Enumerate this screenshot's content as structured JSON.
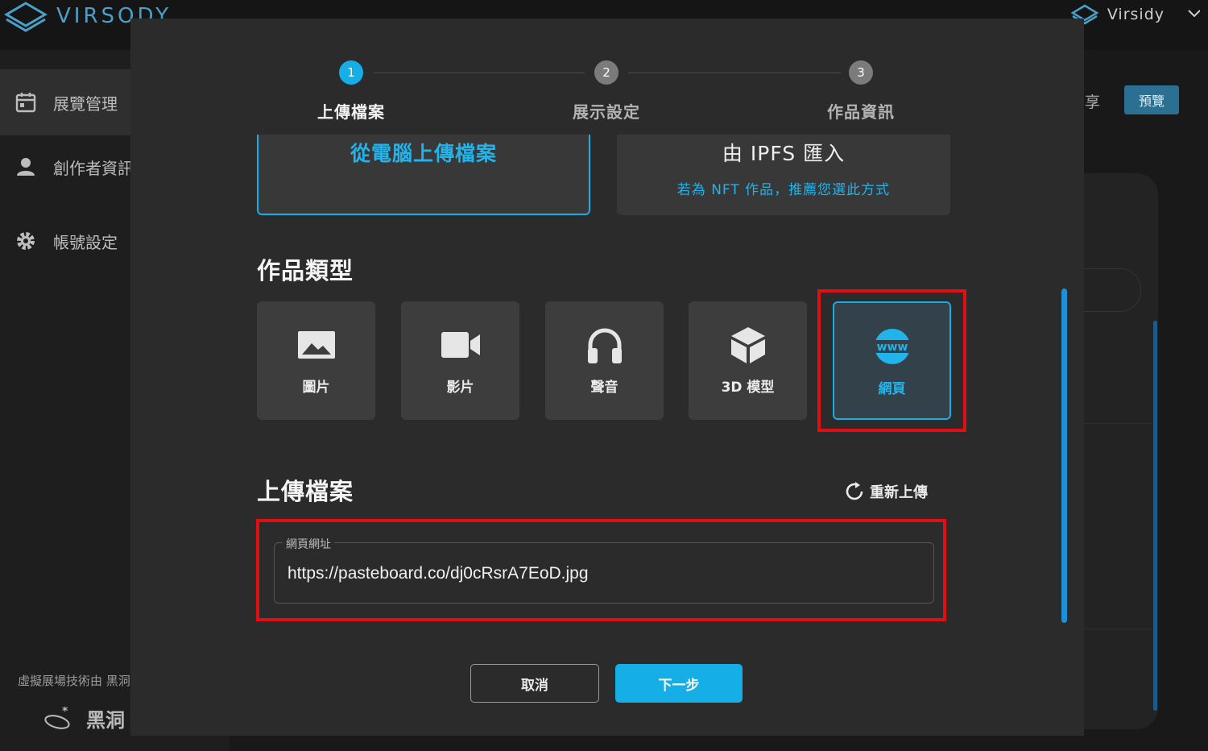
{
  "app": {
    "logo_text": "VIRSODY",
    "user_name": "Virsidy"
  },
  "sidebar": {
    "items": [
      {
        "label": "展覽管理",
        "icon": "calendar-icon"
      },
      {
        "label": "創作者資訊",
        "icon": "person-icon"
      },
      {
        "label": "帳號設定",
        "icon": "gear-icon"
      }
    ],
    "footer_text": "虛擬展場技術由 黑洞",
    "footer_brand": "黑洞"
  },
  "background": {
    "share_text": "享",
    "preview_label": "預覽"
  },
  "modal": {
    "steps": [
      {
        "number": "1",
        "label": "上傳檔案",
        "active": true
      },
      {
        "number": "2",
        "label": "展示設定",
        "active": false
      },
      {
        "number": "3",
        "label": "作品資訊",
        "active": false
      }
    ],
    "source_options": [
      {
        "title": "從電腦上傳檔案",
        "subtitle": "",
        "selected": true
      },
      {
        "title": "由 IPFS 匯入",
        "subtitle": "若為 NFT 作品，推薦您選此方式",
        "selected": false
      }
    ],
    "type_section_title": "作品類型",
    "types": [
      {
        "label": "圖片",
        "icon": "image-icon",
        "selected": false
      },
      {
        "label": "影片",
        "icon": "video-camera-icon",
        "selected": false
      },
      {
        "label": "聲音",
        "icon": "headphones-icon",
        "selected": false
      },
      {
        "label": "3D 模型",
        "icon": "cube-icon",
        "selected": false
      },
      {
        "label": "網頁",
        "icon": "www-globe-icon",
        "selected": true
      }
    ],
    "upload_section_title": "上傳檔案",
    "reupload_label": "重新上傳",
    "url_field": {
      "label": "網頁網址",
      "value": "https://pasteboard.co/dj0cRsrA7EoD.jpg"
    },
    "cancel_label": "取消",
    "next_label": "下一步",
    "accent_color": "#15aee7",
    "highlight_color": "#e30e12"
  }
}
